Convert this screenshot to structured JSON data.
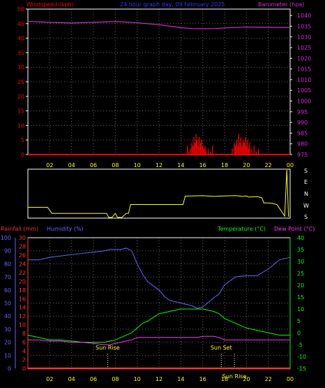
{
  "title": "24 hour graph day, 09 February 2025",
  "colors": {
    "background": "#000000",
    "axis": "#ffffff",
    "wind": "#ff0000",
    "barometer": "#cc33cc",
    "direction": "#ffff00",
    "rain": "#ff3333",
    "humidity": "#6666ff",
    "temperature": "#00ff00",
    "dewpoint": "#ff33ff",
    "sun": "#ffff00"
  },
  "hour_ticks": [
    "02",
    "04",
    "06",
    "08",
    "10",
    "12",
    "14",
    "16",
    "18",
    "20",
    "22",
    "00"
  ],
  "chart_data": [
    {
      "type": "line",
      "title": "",
      "ylabel": "Windspeed (kph)",
      "y2label": "Barometer (hpa)",
      "x": [
        0,
        2,
        4,
        6,
        8,
        10,
        12,
        14,
        16,
        18,
        20,
        22,
        24
      ],
      "ylim": [
        0,
        50
      ],
      "y2lim": [
        975,
        1043
      ],
      "yticks": [
        "0",
        "5",
        "10",
        "15",
        "20",
        "25",
        "30",
        "35",
        "40",
        "45",
        "50"
      ],
      "y2ticks": [
        "975",
        "980",
        "985",
        "990",
        "995",
        "1000",
        "1005",
        "1010",
        "1015",
        "1020",
        "1025",
        "1030",
        "1035",
        "1040"
      ],
      "series": [
        {
          "name": "Barometer (hpa)",
          "axis": "right",
          "x": [
            0,
            2,
            4,
            6,
            8,
            10,
            12,
            14,
            15,
            16,
            17,
            18,
            19,
            20,
            22,
            24
          ],
          "values": [
            1037.3,
            1036.8,
            1036.5,
            1036.8,
            1037.2,
            1036.6,
            1035.7,
            1034.3,
            1033.9,
            1033.8,
            1033.9,
            1034.2,
            1034.4,
            1034.6,
            1034.5,
            1034.4
          ]
        },
        {
          "name": "Windspeed (kph)",
          "axis": "left",
          "style": "bars",
          "x": [
            14.6,
            14.75,
            14.9,
            15.0,
            15.1,
            15.2,
            15.3,
            15.4,
            15.5,
            15.6,
            15.7,
            15.8,
            15.9,
            16.0,
            16.1,
            16.2,
            16.3,
            16.5,
            16.7,
            16.9,
            18.7,
            18.9,
            19.0,
            19.1,
            19.2,
            19.3,
            19.4,
            19.5,
            19.6,
            19.7,
            19.8,
            19.9,
            20.0,
            20.1,
            20.2,
            20.3,
            20.5,
            20.7,
            20.9,
            21.1
          ],
          "values": [
            3,
            1,
            2,
            4,
            3,
            6,
            4,
            7,
            5,
            3,
            6,
            4,
            5,
            3,
            2,
            3,
            1,
            2,
            1,
            3,
            2,
            4,
            3,
            5,
            3,
            7,
            4,
            6,
            3,
            5,
            4,
            6,
            3,
            5,
            2,
            4,
            2,
            3,
            1,
            2
          ]
        }
      ]
    },
    {
      "type": "line",
      "title": "",
      "ylabels": [
        "S",
        "E",
        "N",
        "W",
        "S"
      ],
      "x": [
        0,
        1.8,
        2.2,
        7.2,
        7.4,
        7.7,
        8.0,
        8.2,
        8.6,
        9.0,
        9.2,
        9.4,
        9.8,
        14.2,
        14.4,
        16.0,
        17.0,
        18.0,
        19.0,
        19.6,
        20.0,
        20.2,
        21.0,
        21.4,
        21.6,
        22.0,
        22.4,
        22.8,
        23.0,
        23.3,
        23.5,
        23.7,
        23.85
      ],
      "ylim": [
        0,
        360
      ],
      "series": [
        {
          "name": "Wind direction",
          "values": [
            80,
            80,
            35,
            35,
            5,
            5,
            35,
            5,
            5,
            35,
            35,
            100,
            100,
            100,
            162,
            165,
            160,
            163,
            166,
            160,
            163,
            155,
            158,
            150,
            112,
            112,
            108,
            100,
            75,
            40,
            15,
            355,
            10
          ]
        }
      ]
    },
    {
      "type": "line",
      "title": "",
      "ylabels": [
        "Rainfall (mm)",
        "Humidity (%)",
        "Temperature (°C)",
        "Dew Point (°C)"
      ],
      "x": [
        0,
        1,
        2,
        3,
        4,
        5,
        6,
        7,
        7.5,
        8,
        8.5,
        9,
        9.5,
        10,
        10.5,
        11,
        12,
        12.5,
        13,
        14,
        15,
        15.5,
        16,
        17,
        17.5,
        18,
        19,
        20,
        21,
        22,
        23,
        24
      ],
      "humidity_lim": [
        0,
        100
      ],
      "rain_lim": [
        0,
        30
      ],
      "temp_lim": [
        -15,
        40
      ],
      "humidity_ticks": [
        "0",
        "10",
        "20",
        "30",
        "40",
        "50",
        "60",
        "70",
        "80",
        "90",
        "100"
      ],
      "rain_ticks": [
        "0",
        "2",
        "4",
        "6",
        "8",
        "10",
        "12",
        "14",
        "16",
        "18",
        "20",
        "22",
        "24",
        "26",
        "28",
        "30"
      ],
      "temp_ticks": [
        "-15",
        "-10",
        "-5",
        "0",
        "5",
        "10",
        "15",
        "20",
        "25",
        "30",
        "35",
        "40"
      ],
      "series": [
        {
          "name": "Humidity (%)",
          "axis": "humidity",
          "values": [
            83,
            83,
            85,
            86,
            87,
            88,
            89,
            90,
            91,
            91,
            91,
            92,
            90,
            80,
            72,
            66,
            60,
            55,
            52,
            50,
            48,
            46,
            47,
            54,
            57,
            64,
            70,
            71,
            71,
            76,
            83,
            85
          ]
        },
        {
          "name": "Temperature (°C)",
          "axis": "temp",
          "values": [
            -1,
            -2,
            -3,
            -3,
            -3.5,
            -4,
            -4,
            -4,
            -3.5,
            -3,
            -2,
            -1,
            0,
            2,
            4,
            5,
            8,
            8.5,
            9,
            10,
            10,
            10,
            10,
            9,
            8,
            6,
            4,
            2,
            1,
            0,
            -1,
            -1
          ]
        },
        {
          "name": "Dew Point (°C)",
          "axis": "temp",
          "values": [
            -3,
            -3,
            -3.5,
            -3.5,
            -4,
            -4,
            -4.5,
            -5,
            -5,
            -4.5,
            -4,
            -3.5,
            -3,
            -2,
            -2,
            -2,
            -2,
            -2,
            -2,
            -2,
            -2,
            -2,
            -1.5,
            -1.5,
            -2,
            -3,
            -3,
            -3,
            -3,
            -3,
            -3,
            -3
          ]
        },
        {
          "name": "Rainfall (mm)",
          "axis": "rain",
          "values": [
            0,
            0,
            0,
            0,
            0,
            0,
            0,
            0,
            0,
            0,
            0,
            0,
            0,
            0,
            0,
            0,
            0,
            0,
            0,
            0,
            0,
            0,
            0,
            0,
            0,
            0,
            0,
            0,
            0,
            0,
            0,
            0
          ]
        }
      ],
      "annotations": [
        {
          "text": "Sun Rise",
          "x": 7.3
        },
        {
          "text": "Sun Set",
          "x": 17.7
        },
        {
          "text": "Sun Rise",
          "x": 18.9
        }
      ]
    }
  ]
}
